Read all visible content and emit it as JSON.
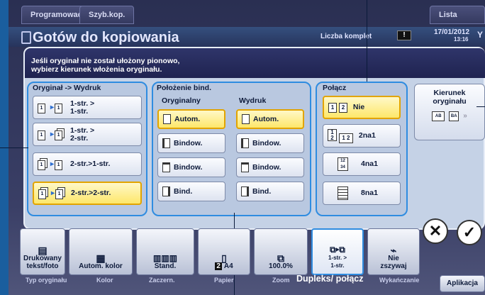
{
  "tabs": {
    "programowac": "Programować",
    "szyb_kop": "Szyb.kop.",
    "lista_zadan": "Lista zadań"
  },
  "header": {
    "title": "Gotów do kopiowania",
    "liczba": "Liczba komplet",
    "warn": "!",
    "date": "17/01/2012",
    "time": "13:16",
    "side_letter": "Y"
  },
  "dialog": {
    "message": "Jeśli oryginał nie został ułożony pionowo,\nwybierz kierunek włożenia oryginału."
  },
  "oryginal_wydruk": {
    "title": "Oryginał -> Wydruk",
    "options": [
      {
        "label": "1-str. >\n1-str.",
        "selected": false
      },
      {
        "label": "1-str. >\n2-str.",
        "selected": false
      },
      {
        "label": "2-str.>1-str.",
        "selected": false
      },
      {
        "label": "2-str.>2-str.",
        "selected": true
      }
    ]
  },
  "polozenie": {
    "title": "Położenie bind.",
    "oryginalny_title": "Oryginalny",
    "wydruk_title": "Wydruk",
    "oryginalny": [
      {
        "label": "Autom.",
        "selected": true
      },
      {
        "label": "Bindow.",
        "selected": false
      },
      {
        "label": "Bindow.",
        "selected": false
      },
      {
        "label": "Bind.",
        "selected": false
      }
    ],
    "wydruk": [
      {
        "label": "Autom.",
        "selected": true
      },
      {
        "label": "Bindow.",
        "selected": false
      },
      {
        "label": "Bindow.",
        "selected": false
      },
      {
        "label": "Bind.",
        "selected": false
      }
    ]
  },
  "polacz": {
    "title": "Połącz",
    "options": [
      {
        "label": "Nie",
        "selected": true
      },
      {
        "label": "2na1",
        "selected": false
      },
      {
        "label": "4na1",
        "selected": false
      },
      {
        "label": "8na1",
        "selected": false
      }
    ]
  },
  "kierunek": {
    "label": "Kierunek\noryginału"
  },
  "bottom": {
    "items": [
      {
        "label": "Drukowany\ntekst/foto",
        "caption": "Typ oryginału"
      },
      {
        "label": "Autom. kolor",
        "caption": "Kolor"
      },
      {
        "label": "Stand.",
        "caption": "Zaczern."
      },
      {
        "label": "A4",
        "caption": "Papier"
      },
      {
        "label": "100.0%",
        "caption": "Zoom"
      },
      {
        "label": "1-str. >\n1-str.",
        "caption": "Dupleks/ połącz"
      },
      {
        "label": "Nie\nzszywaj",
        "caption": "Wykańczanie"
      }
    ],
    "aplikacja": "Aplikacja",
    "cancel_symbol": "✕",
    "ok_symbol": "✓"
  },
  "colors": {
    "selected": "#fde76a",
    "group_border": "#2f8ce0",
    "background": "#1a5e9e"
  }
}
